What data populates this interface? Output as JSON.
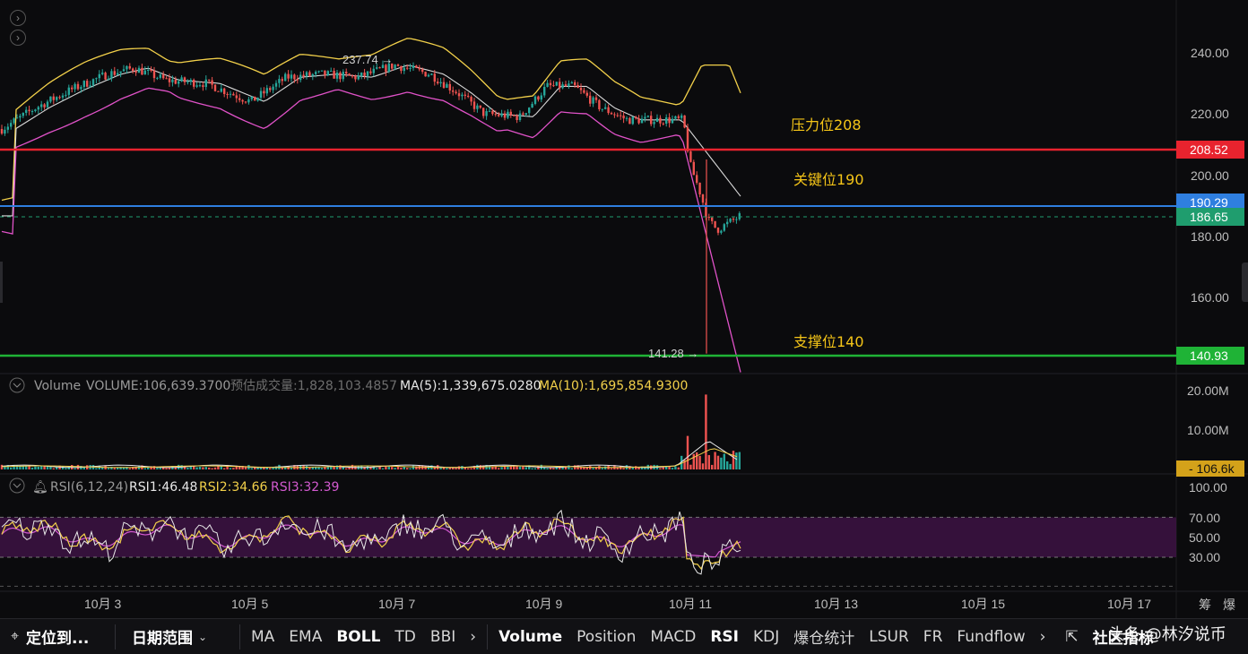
{
  "price_axis": {
    "ticks": [
      "240.00",
      "220.00",
      "200.00",
      "180.00",
      "160.00"
    ]
  },
  "price_tags": [
    {
      "label": "208.52",
      "bg": "#e8232e",
      "fg": "#ffffff"
    },
    {
      "label": "190.29",
      "bg": "#2f7fe0",
      "fg": "#ffffff"
    },
    {
      "label": "186.65",
      "bg": "#1f9d6e",
      "fg": "#ffffff"
    },
    {
      "label": "140.93",
      "bg": "#1fb336",
      "fg": "#ffffff"
    }
  ],
  "annotations": [
    {
      "text": "压力位208"
    },
    {
      "text": "关键位190"
    },
    {
      "text": "支撑位140"
    }
  ],
  "hilo": {
    "high": "237.74 →",
    "low": "141.28 →"
  },
  "volume_header": {
    "name": "Volume",
    "volume": "VOLUME:106,639.3700",
    "est": "预估成交量:1,828,103.4857",
    "ma5": "MA(5):1,339,675.0280",
    "ma10": "MA(10):1,695,854.9300"
  },
  "volume_axis": {
    "ticks": [
      "20.00M",
      "10.00M"
    ],
    "current": "106.6k"
  },
  "rsi_header": {
    "name": "RSI(6,12,24)",
    "rsi1": "RSI1:46.48",
    "rsi2": "RSI2:34.66",
    "rsi3": "RSI3:32.39"
  },
  "rsi_axis": {
    "ticks": [
      "100.00",
      "70.00",
      "50.00",
      "30.00"
    ]
  },
  "dates": [
    "10月 3",
    "10月 5",
    "10月 7",
    "10月 9",
    "10月 11",
    "10月 13",
    "10月 15",
    "10月 17"
  ],
  "corner_labels": [
    "筹",
    "爆"
  ],
  "toolbar": {
    "locate": "定位到...",
    "range": "日期范围",
    "indicators_main": [
      "MA",
      "EMA",
      "BOLL",
      "TD",
      "BBI"
    ],
    "indicators_sub": [
      "Volume",
      "Position",
      "MACD",
      "RSI",
      "KDJ",
      "爆仓统计",
      "LSUR",
      "FR",
      "Fundflow"
    ],
    "community": "社区指标",
    "extra": "X指"
  },
  "watermark": "头条 @林汐说币",
  "colors": {
    "up": "#26a69a",
    "down": "#ef5350",
    "boll_upper": "#f2d04a",
    "boll_mid": "#d8d8d8",
    "boll_lower": "#e052c8",
    "rsi1": "#e8e8e8",
    "rsi2": "#f2d04a",
    "rsi3": "#d35ad0"
  }
}
